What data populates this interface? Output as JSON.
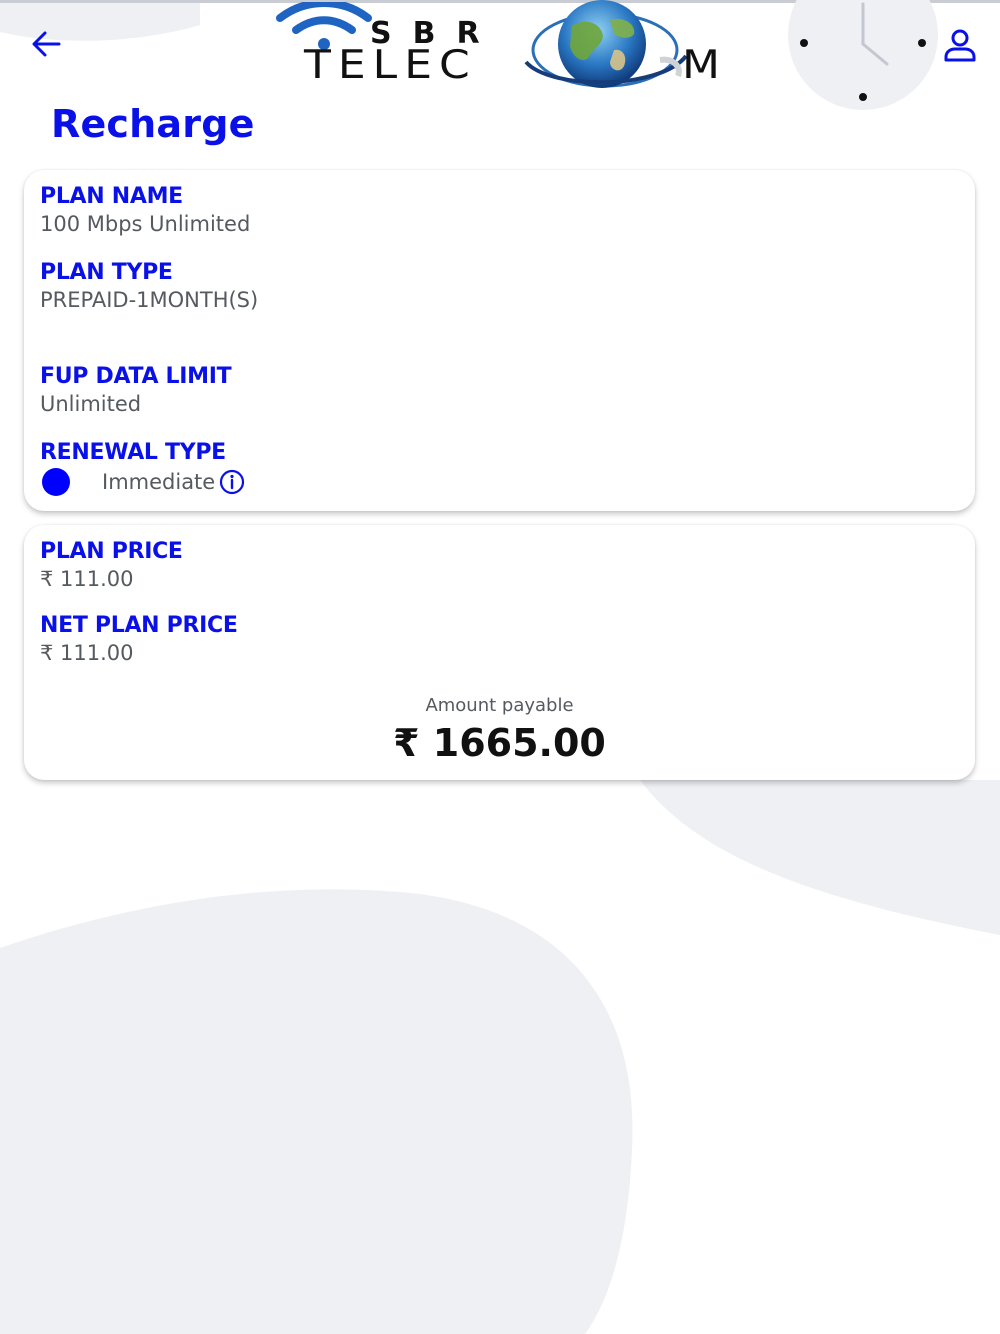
{
  "header": {
    "back_icon": "arrow-left-icon",
    "brand": {
      "line1": "SBR",
      "line2": "TELEC",
      "line2_end": "M"
    },
    "profile_icon": "user-icon"
  },
  "page": {
    "title": "Recharge"
  },
  "plan_details": {
    "plan_name_label": "PLAN NAME",
    "plan_name_value": "100 Mbps Unlimited",
    "plan_type_label": "PLAN TYPE",
    "plan_type_value": "PREPAID-1MONTH(S)",
    "fup_label": "FUP DATA LIMIT",
    "fup_value": "Unlimited",
    "renewal_label": "RENEWAL TYPE",
    "renewal_option": "Immediate",
    "renewal_selected": true
  },
  "pricing": {
    "plan_price_label": "PLAN PRICE",
    "plan_price_value": "₹ 111.00",
    "net_price_label": "NET PLAN PRICE",
    "net_price_value": "₹ 111.00",
    "amount_caption": "Amount payable",
    "amount_value": "₹ 1665.00"
  },
  "colors": {
    "accent": "#0a10e8",
    "radio": "#0000ff",
    "muted_text": "#555a60",
    "background_shape": "#f1f2f4"
  }
}
